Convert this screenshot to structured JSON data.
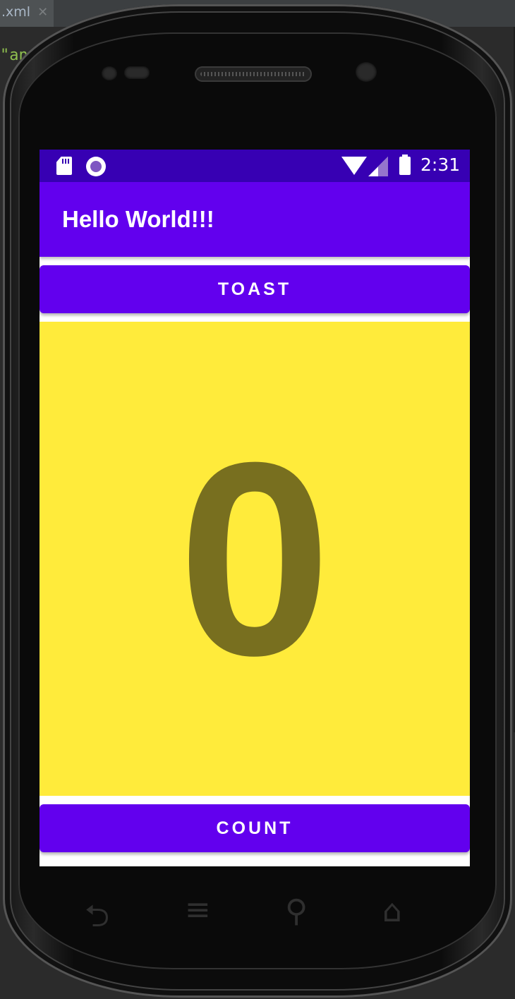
{
  "ide": {
    "tab_label": ".xml",
    "tab_close": "✕",
    "code_fragment": "\"an"
  },
  "status_bar": {
    "time": "2:31",
    "icons": [
      "sd-card-icon",
      "circle-notification-icon",
      "wifi-icon",
      "signal-icon",
      "battery-icon"
    ]
  },
  "app_bar": {
    "title": "Hello World!!!"
  },
  "buttons": {
    "toast_label": "TOAST",
    "count_label": "COUNT"
  },
  "counter": {
    "value": "0"
  },
  "nav_keys": {
    "back": "⮌",
    "menu": "≡",
    "search": "⚲",
    "home": "⌂"
  },
  "colors": {
    "status_bar": "#3700b3",
    "primary": "#6200ee",
    "count_background": "#ffeb3b",
    "count_text": "#786f1f"
  }
}
